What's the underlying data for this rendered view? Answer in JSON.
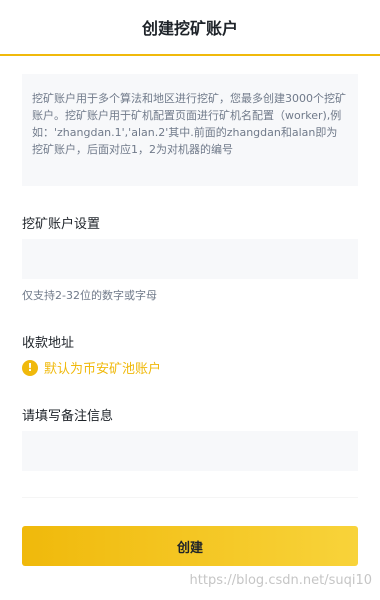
{
  "header": {
    "title": "创建挖矿账户"
  },
  "notice": {
    "text": "挖矿账户用于多个算法和地区进行挖矿，您最多创建3000个挖矿账户。挖矿账户用于矿机配置页面进行矿机名配置（worker),例如：'zhangdan.1','alan.2'其中.前面的zhangdan和alan即为挖矿账户，后面对应1，2为对机器的编号"
  },
  "account_setting": {
    "label": "挖矿账户设置",
    "value": "",
    "placeholder": "",
    "hint": "仅支持2-32位的数字或字母"
  },
  "payout_address": {
    "label": "收款地址",
    "icon": "warning-icon",
    "value": "默认为币安矿池账户",
    "accent": "#f0b90b"
  },
  "remark": {
    "label": "请填写备注信息",
    "value": "",
    "placeholder": ""
  },
  "create_button": {
    "label": "创建"
  },
  "watermark": {
    "text": "https://blog.csdn.net/suqi10"
  }
}
